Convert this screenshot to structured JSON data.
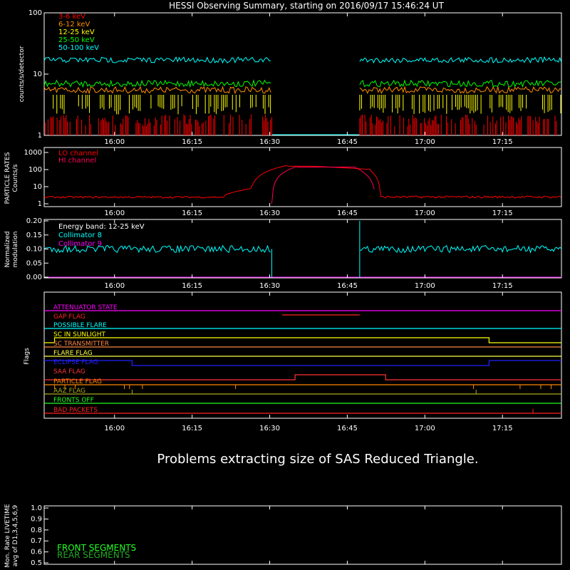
{
  "title": "HESSI Observing Summary, starting on 2016/09/17 15:46:24 UT",
  "time_ticks": [
    "16:00",
    "16:15",
    "16:30",
    "16:45",
    "17:00",
    "17:15"
  ],
  "message": "Problems extracting size of SAS Reduced Triangle.",
  "chart_data": [
    {
      "type": "line",
      "panel": "count-rates",
      "ylabel": "counts/s/detector",
      "yscale": "log",
      "ylim": [
        1,
        100
      ],
      "ytick_labels": [
        "1",
        "10",
        "100"
      ],
      "x_range_minutes": [
        0,
        100
      ],
      "legend_placement": "top-left",
      "series": [
        {
          "name": "3-6 keV",
          "color": "#ff0000",
          "approx_level": 1.6,
          "segments": [
            [
              0,
              44
            ],
            [
              61,
              100
            ]
          ]
        },
        {
          "name": "6-12 keV",
          "color": "#ff8c00",
          "approx_level": 5.5,
          "segments": [
            [
              0,
              44
            ],
            [
              61,
              100
            ]
          ]
        },
        {
          "name": "12-25 keV",
          "color": "#ffff00",
          "approx_level": 3.5,
          "segments": [
            [
              0,
              44
            ],
            [
              61,
              100
            ]
          ]
        },
        {
          "name": "25-50 keV",
          "color": "#00ff00",
          "approx_level": 7,
          "segments": [
            [
              0,
              44
            ],
            [
              61,
              100
            ]
          ]
        },
        {
          "name": "50-100 keV",
          "color": "#00ffff",
          "approx_level": 17,
          "segments": [
            [
              0,
              44
            ],
            [
              61,
              100
            ]
          ]
        }
      ]
    },
    {
      "type": "line",
      "panel": "particle-rates",
      "ylabel_line1": "PARTICLE RATES",
      "ylabel_line2": "Counts/s",
      "yscale": "log",
      "ylim": [
        0.7,
        1000
      ],
      "ytick_labels": [
        "1",
        "10",
        "100",
        "1000"
      ],
      "series": [
        {
          "name": "LO channel",
          "color": "#ff0000"
        },
        {
          "name": "HI channel",
          "color": "#ff0055"
        }
      ]
    },
    {
      "type": "line",
      "panel": "modulation",
      "ylabel_line1": "Normalized",
      "ylabel_line2": "modulation",
      "ylim": [
        0.0,
        0.2
      ],
      "ytick_labels": [
        "0.00",
        "0.05",
        "0.10",
        "0.15",
        "0.20"
      ],
      "annotation": "Energy band: 12-25 keV",
      "series": [
        {
          "name": "Collimator 8",
          "color": "#00ffff",
          "approx_level": 0.1
        },
        {
          "name": "Collimator 9",
          "color": "#ff00ff",
          "approx_level": 0.0
        }
      ]
    },
    {
      "type": "line",
      "panel": "flags",
      "ylabel": "Flags",
      "series": [
        {
          "name": "ATTENUATOR STATE",
          "color": "#ff00ff"
        },
        {
          "name": "GAP FLAG",
          "color": "#ff2222"
        },
        {
          "name": "POSSIBLE FLARE",
          "color": "#00ffff"
        },
        {
          "name": "SC IN SUNLIGHT",
          "color": "#ffff00"
        },
        {
          "name": "SC TRANSMITTER",
          "color": "#ff8844"
        },
        {
          "name": "FLARE FLAG",
          "color": "#ffff44"
        },
        {
          "name": "ECLIPSE FLAG",
          "color": "#2222ff"
        },
        {
          "name": "SAA FLAG",
          "color": "#ff3333"
        },
        {
          "name": "PARTICLE FLAG",
          "color": "#ff8800"
        },
        {
          "name": "AAZ FLAG",
          "color": "#aaaa22"
        },
        {
          "name": "FRONTS OFF",
          "color": "#22ff22"
        },
        {
          "name": "BAD PACKETS",
          "color": "#ff2222"
        }
      ]
    },
    {
      "type": "line",
      "panel": "livetime",
      "ylabel_line1": "Mon. Rate LIVETIME",
      "ylabel_line2": "avg of D1,3,4,5,6,9",
      "ylim": [
        0.5,
        1.0
      ],
      "ytick_labels": [
        "0.5",
        "0.6",
        "0.7",
        "0.8",
        "0.9",
        "1.0"
      ],
      "series": [
        {
          "name": "FRONT SEGMENTS",
          "color": "#22ff22"
        },
        {
          "name": "REAR SEGMENTS",
          "color": "#22aa22"
        }
      ]
    }
  ]
}
